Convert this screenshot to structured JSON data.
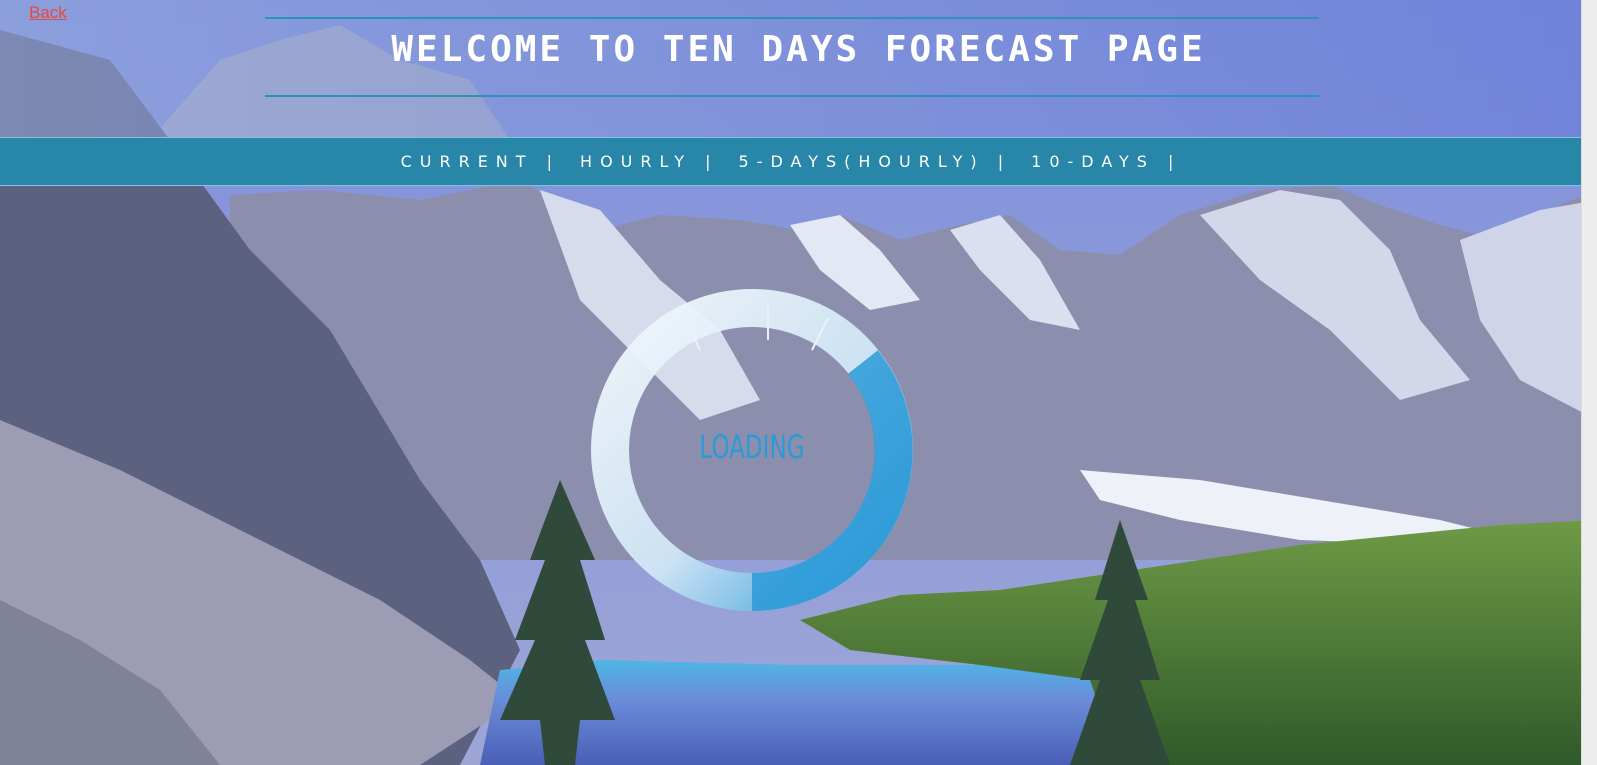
{
  "header": {
    "title": "WELCOME TO TEN DAYS FORECAST PAGE",
    "back_label": "Back"
  },
  "nav": {
    "items": [
      {
        "label": "CURRENT |"
      },
      {
        "label": "HOURLY |"
      },
      {
        "label": "5-DAYS(HOURLY) |"
      },
      {
        "label": "10-DAYS |"
      }
    ]
  },
  "loader": {
    "label": "LOADING"
  },
  "colors": {
    "accent": "#2887a8",
    "loader_blue": "#2a9ad8",
    "back_link": "#e8483e"
  }
}
